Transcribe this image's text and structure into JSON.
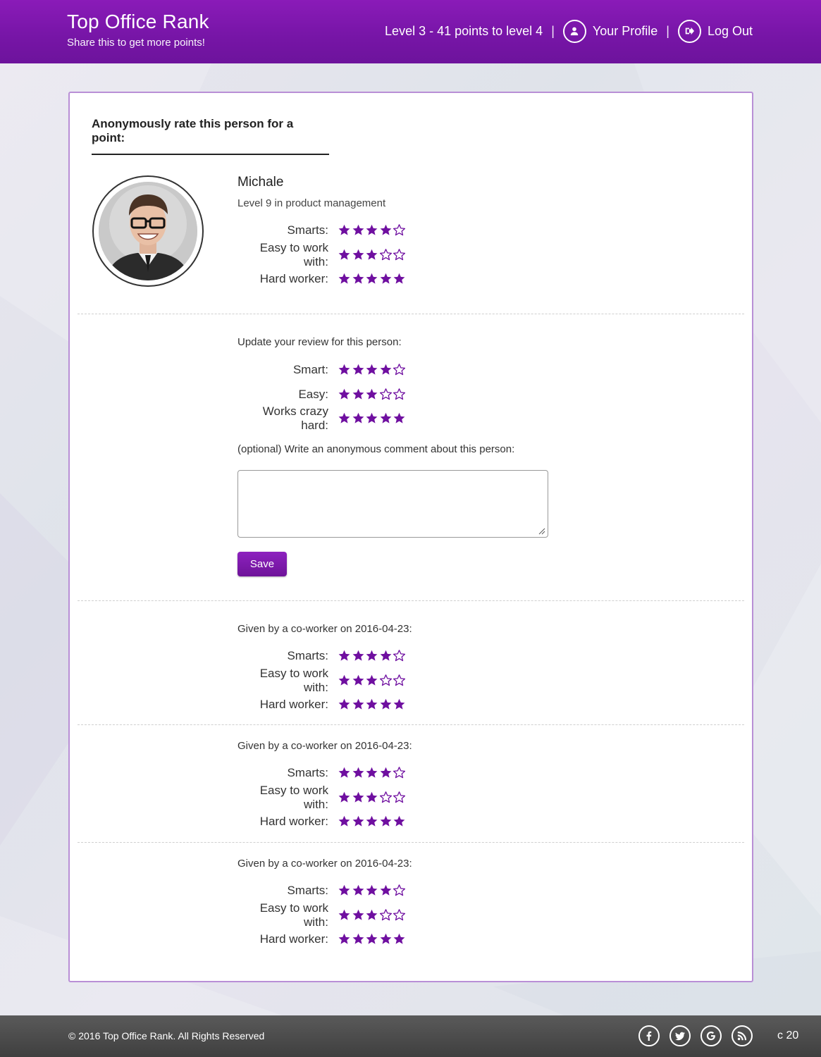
{
  "header": {
    "brand_title": "Top Office Rank",
    "brand_sub": "Share this to get more points!",
    "level_text": "Level 3 - 41 points to level 4",
    "separator": "|",
    "profile_label": "Your Profile",
    "logout_label": "Log Out"
  },
  "card": {
    "title": "Anonymously rate this person for a point:",
    "person": {
      "name": "Michale",
      "level": "Level 9 in product management",
      "ratings": [
        {
          "label": "Smarts:",
          "stars": 4
        },
        {
          "label": "Easy to work with:",
          "stars": 3
        },
        {
          "label": "Hard worker:",
          "stars": 5
        }
      ]
    },
    "update": {
      "heading": "Update your review for this person:",
      "ratings": [
        {
          "label": "Smart:",
          "stars": 4
        },
        {
          "label": "Easy:",
          "stars": 3
        },
        {
          "label": "Works crazy hard:",
          "stars": 5
        }
      ],
      "comment_label": "(optional) Write an anonymous comment about this person:",
      "comment_value": "",
      "save_label": "Save"
    },
    "reviews": [
      {
        "heading": "Given by a co-worker on 2016-04-23:",
        "ratings": [
          {
            "label": "Smarts:",
            "stars": 4
          },
          {
            "label": "Easy to work with:",
            "stars": 3
          },
          {
            "label": "Hard worker:",
            "stars": 5
          }
        ]
      },
      {
        "heading": "Given by a co-worker on 2016-04-23:",
        "ratings": [
          {
            "label": "Smarts:",
            "stars": 4
          },
          {
            "label": "Easy to work with:",
            "stars": 3
          },
          {
            "label": "Hard worker:",
            "stars": 5
          }
        ]
      },
      {
        "heading": "Given by a co-worker on 2016-04-23:",
        "ratings": [
          {
            "label": "Smarts:",
            "stars": 4
          },
          {
            "label": "Easy to work with:",
            "stars": 3
          },
          {
            "label": "Hard worker:",
            "stars": 5
          }
        ]
      }
    ],
    "max_stars": 5
  },
  "footer": {
    "copyright": "© 2016 Top Office Rank. All Rights Reserved",
    "right_text": "c 20",
    "socials": [
      "facebook-icon",
      "twitter-icon",
      "google-icon",
      "rss-icon"
    ]
  },
  "colors": {
    "accent": "#7a16aa",
    "star": "#6f0fa0",
    "card_border": "#b98fd6"
  }
}
